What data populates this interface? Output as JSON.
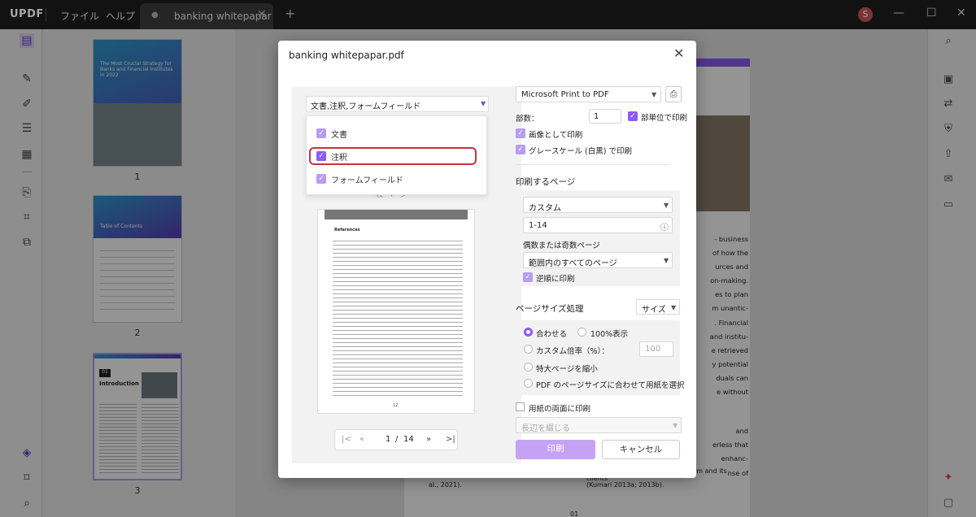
{
  "app": {
    "logo": "UPDF",
    "menu_file": "ファイル",
    "menu_help": "ヘルプ",
    "tab_title": "banking whitepapar",
    "avatar_letter": "S"
  },
  "thumbnails": {
    "page1_num": "1",
    "page2_num": "2",
    "page3_num": "3",
    "page1_title": "The Most Crucial Strategy for Banks and Financial Institutes in 2022",
    "page2_title": "Table of Contents",
    "page3_heading": "Introduction",
    "page3_num_label": "01"
  },
  "document": {
    "lines": [
      "- business",
      "of how the",
      "urces and",
      "on-making.",
      "es to plan",
      "m unantic-",
      ". Financial",
      "and institu-",
      "e retrieved",
      "y potential",
      "duals can",
      "e without"
    ],
    "lower_lines": [
      "and",
      "erless that",
      "enhanc-",
      "nse of"
    ],
    "bottom_left": "al., 2021).",
    "bottom_right_1": "social responsibility among the firm and its clients",
    "bottom_right_2": "(Kumari 2013a; 2013b).",
    "page_number": "01"
  },
  "dialog": {
    "title": "banking whitepapar.pdf",
    "layer_select": "文書,注釈,フォームフィールド",
    "layer_options": [
      {
        "label": "文書"
      },
      {
        "label": "注釈"
      },
      {
        "label": "フォームフィールド"
      }
    ],
    "preview_hint": "枚  ページ",
    "preview_heading": "References",
    "preview_page_num": "12",
    "pager": {
      "current": "1",
      "sep": "/",
      "total": "14"
    },
    "printer": "Microsoft Print to PDF",
    "copies_label": "部数：",
    "copies_value": "1",
    "collate_label": "部単位で印刷",
    "print_as_image": "画像として印刷",
    "grayscale": "グレースケール (白黒) で印刷",
    "pages_heading": "印刷するページ",
    "pages_mode": "カスタム",
    "pages_range": "1-14",
    "odd_even_label": "偶数または奇数ページ",
    "odd_even_value": "範囲内のすべてのページ",
    "reverse": "逆順に印刷",
    "size_heading": "ページサイズ処理",
    "size_mode": "サイズ",
    "fit": "合わせる",
    "actual": "100%表示",
    "custom_scale": "カスタム倍率（%）：",
    "scale_value": "100",
    "shrink": "特大ページを縮小",
    "choose_paper": "PDF のページサイズに合わせて用紙を選択",
    "duplex": "用紙の両面に印刷",
    "binding": "長辺を綴じる",
    "print_btn": "印刷",
    "cancel_btn": "キャンセル"
  }
}
